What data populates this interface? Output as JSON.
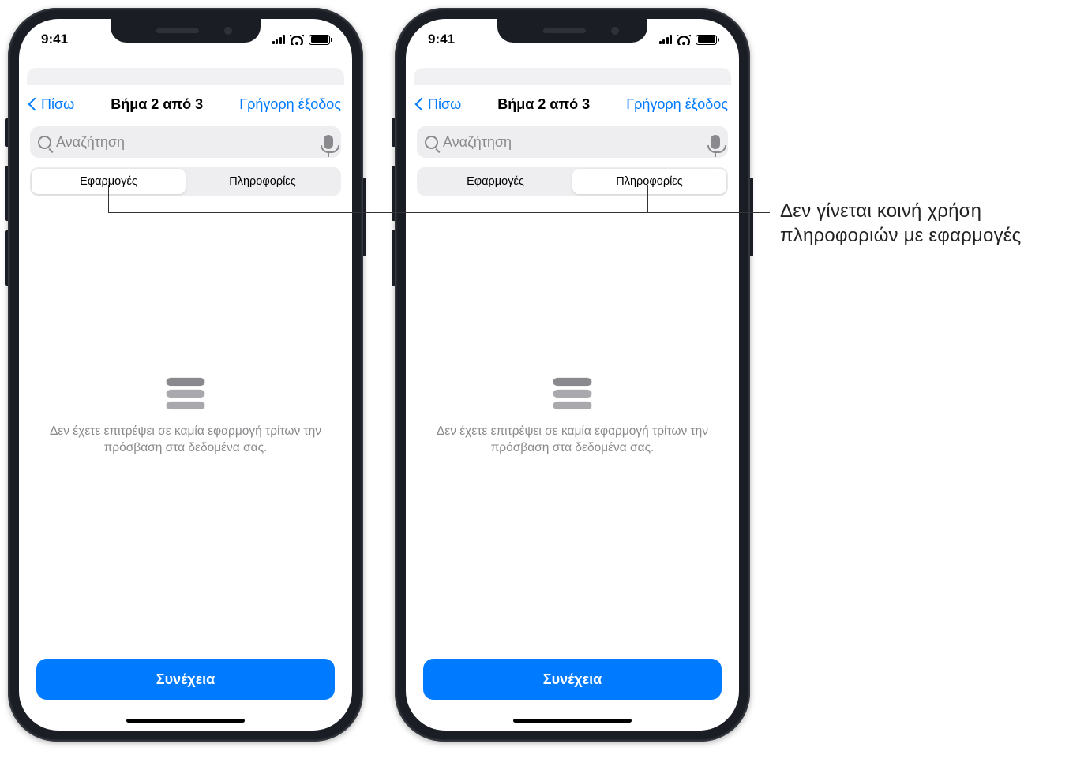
{
  "status": {
    "time": "9:41"
  },
  "nav": {
    "back": "Πίσω",
    "title": "Βήμα 2 από 3",
    "quick_exit": "Γρήγορη έξοδος"
  },
  "search": {
    "placeholder": "Αναζήτηση"
  },
  "segments": {
    "apps": "Εφαρμογές",
    "info": "Πληροφορίες"
  },
  "empty_state": {
    "message": "Δεν έχετε επιτρέψει σε καμία εφαρμογή τρίτων την πρόσβαση στα δεδομένα σας."
  },
  "continue_label": "Συνέχεια",
  "callout": "Δεν γίνεται κοινή χρήση πληροφοριών με εφαρμογές"
}
